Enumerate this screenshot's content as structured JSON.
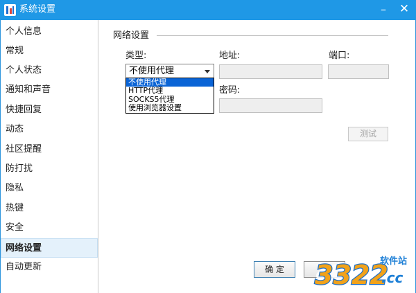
{
  "window": {
    "title": "系统设置",
    "minimize_glyph": "–",
    "close_glyph": "✕",
    "app_icon": "qq-app-icon"
  },
  "sidebar": {
    "items": [
      {
        "label": "个人信息"
      },
      {
        "label": "常规"
      },
      {
        "label": "个人状态"
      },
      {
        "label": "通知和声音"
      },
      {
        "label": "快捷回复"
      },
      {
        "label": "动态"
      },
      {
        "label": "社区提醒"
      },
      {
        "label": "防打扰"
      },
      {
        "label": "隐私"
      },
      {
        "label": "热键"
      },
      {
        "label": "安全"
      },
      {
        "label": "网络设置",
        "active": true
      },
      {
        "label": "自动更新"
      }
    ]
  },
  "network": {
    "section_title": "网络设置",
    "type_label": "类型:",
    "address_label": "地址:",
    "port_label": "端口:",
    "password_label": "密码:",
    "type_selected": "不使用代理",
    "address_value": "",
    "port_value": "",
    "password_value": "",
    "dropdown_options": [
      "不使用代理",
      "HTTP代理",
      "SOCKS5代理",
      "使用浏览器设置"
    ],
    "test_label": "测试"
  },
  "footer": {
    "ok_label": "确 定",
    "cancel_label": ""
  },
  "watermark": {
    "number": "3322",
    "site": "软件站",
    "domain": ".cc"
  },
  "colors": {
    "titlebar": "#1f98e6",
    "selection": "#0a64d6",
    "active_nav_bg": "#e4f1fb"
  }
}
